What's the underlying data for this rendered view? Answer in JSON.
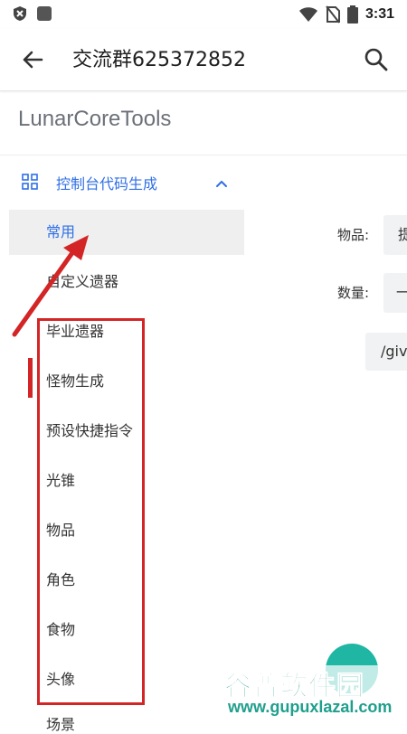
{
  "status": {
    "time": "3:31"
  },
  "appbar": {
    "title": "交流群625372852"
  },
  "brand": "LunarCoreTools",
  "section": {
    "label": "控制台代码生成"
  },
  "sidebar_items": [
    {
      "label": "常用",
      "active": true
    },
    {
      "label": "自定义遗器"
    },
    {
      "label": "毕业遗器"
    },
    {
      "label": "怪物生成"
    },
    {
      "label": "预设快捷指令"
    },
    {
      "label": "光锥"
    },
    {
      "label": "物品"
    },
    {
      "label": "角色"
    },
    {
      "label": "食物"
    },
    {
      "label": "头像"
    }
  ],
  "partial_item": "场景",
  "right_panel": {
    "item_label": "物品:",
    "item_value": "提",
    "count_label": "数量:",
    "count_value": "一",
    "command_text": "/giv"
  },
  "watermark": {
    "main": "谷普软件园",
    "url": "www.gupuxlazal.com"
  },
  "colors": {
    "accent": "#2f6fe6",
    "annotation": "#d32525",
    "fab": "#1fb6a4"
  }
}
